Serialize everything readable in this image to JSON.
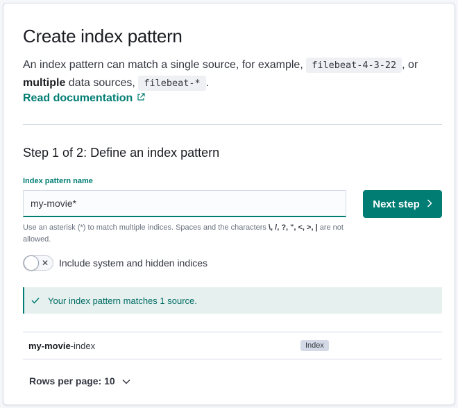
{
  "page": {
    "title": "Create index pattern",
    "intro_text_1": "An index pattern can match a single source, for example,",
    "intro_code_1": "filebeat-4-3-22",
    "intro_text_2": ", or",
    "intro_bold": "multiple",
    "intro_text_3": "data sources,",
    "intro_code_2": "filebeat-*",
    "intro_text_4": ".",
    "read_doc_label": "Read documentation",
    "read_doc_icon": "external-link-icon"
  },
  "step": {
    "title": "Step 1 of 2: Define an index pattern",
    "field_label": "Index pattern name",
    "input_value": "my-movie*",
    "next_button_label": "Next step",
    "next_button_icon": "chevron-right-icon",
    "help_text_1": "Use an asterisk (*) to match multiple indices. Spaces and the characters",
    "help_chars": "\\, /, ?, \", <, >, |",
    "help_text_2": "are not allowed.",
    "toggle_label": "Include system and hidden indices",
    "toggle_on": false
  },
  "callout": {
    "icon": "check-icon",
    "text": "Your index pattern matches 1 source."
  },
  "table": {
    "rows": [
      {
        "name_bold": "my-movie",
        "name_rest": "-index",
        "type": "Index"
      }
    ]
  },
  "pagination": {
    "label": "Rows per page: 10",
    "icon": "chevron-down-icon"
  },
  "colors": {
    "accent": "#017d73",
    "callout_bg": "#e6f1ef",
    "border": "#d3dae6"
  }
}
